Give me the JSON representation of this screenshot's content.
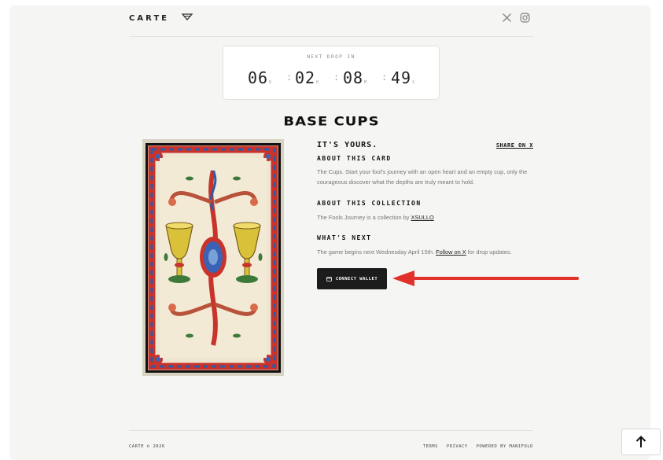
{
  "header": {
    "logo": "CARTE",
    "icons": [
      "logo-mark-icon",
      "x-icon",
      "instagram-icon"
    ]
  },
  "countdown": {
    "label": "NEXT DROP IN",
    "units": [
      {
        "value": "06",
        "suffix": "D"
      },
      {
        "value": "02",
        "suffix": "H"
      },
      {
        "value": "08",
        "suffix": "M"
      },
      {
        "value": "49",
        "suffix": "S"
      }
    ],
    "separator": ":"
  },
  "title": "BASE CUPS",
  "details": {
    "headline": "IT'S YOURS.",
    "share_label": "SHARE ON X",
    "about_card": {
      "heading": "ABOUT THIS CARD",
      "text": "The Cups. Start your fool's journey with an open heart and an empty cup, only the courageous discover what the depths are truly meant to hold."
    },
    "about_collection": {
      "heading": "ABOUT THIS COLLECTION",
      "text_before": "The Fools Journey is a collection by ",
      "link": "XSULLO"
    },
    "whats_next": {
      "heading": "WHAT'S NEXT",
      "text_before": "The game begins next Wednesday April 15th. ",
      "link": "Follow on X",
      "text_after": " for drop updates."
    },
    "connect_label": "CONNECT WALLET"
  },
  "footer": {
    "copyright": "CARTE © 2026",
    "links": [
      "TERMS",
      "PRIVACY",
      "POWERED BY MANIFOLD"
    ]
  },
  "colors": {
    "background": "#f5f5f3",
    "button": "#1c1c1c",
    "annotation_arrow": "#e0312a"
  }
}
